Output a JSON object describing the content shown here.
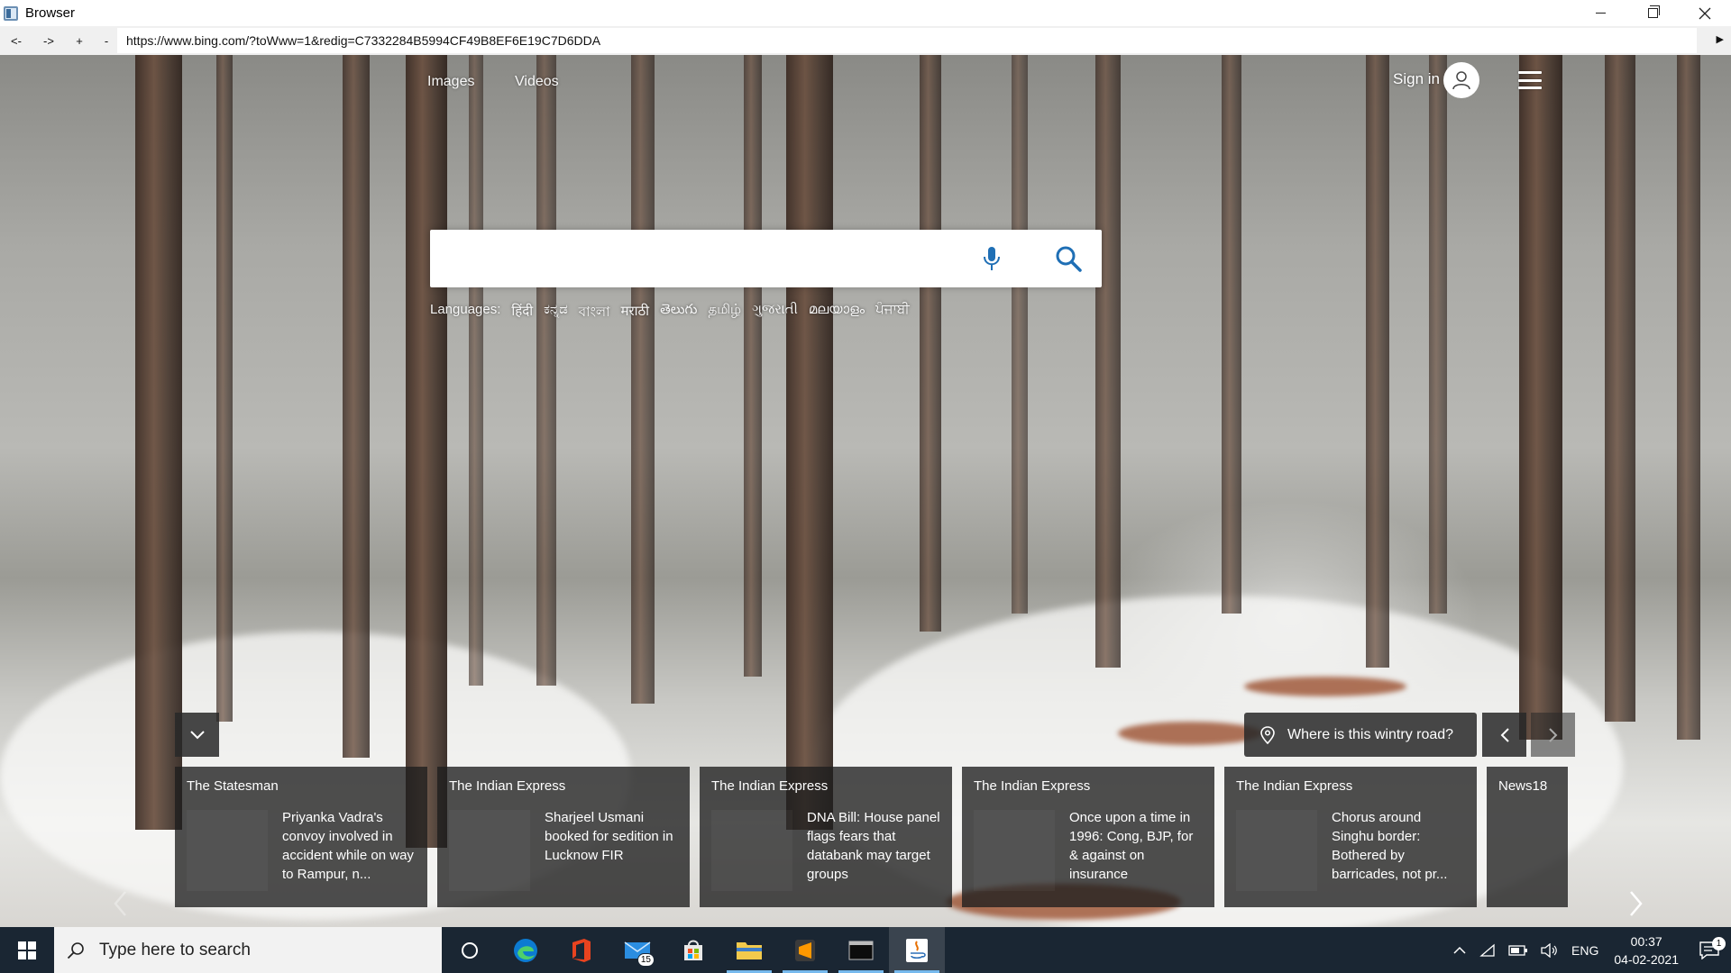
{
  "window": {
    "title": "Browser",
    "minimize": "–",
    "maximize": "❐",
    "close": "✕"
  },
  "navbar": {
    "back": "<-",
    "forward": "->",
    "zoom_in": "+",
    "zoom_out": "-",
    "url": "https://www.bing.com/?toWww=1&redig=C7332284B5994CF49B8EF6E19C7D6DDA",
    "go": "▶"
  },
  "bing": {
    "nav": {
      "images": "Images",
      "videos": "Videos"
    },
    "signin": "Sign in",
    "search": {
      "placeholder": "",
      "value": ""
    },
    "languages_label": "Languages:",
    "languages": [
      "हिंदी",
      "ಕನ್ನಡ",
      "বাংলা",
      "मराठी",
      "తెలుగు",
      "தமிழ்",
      "ગુજરાતી",
      "മലയാളം",
      "ਪੰਜਾਬੀ"
    ],
    "location_question": "Where is this wintry road?",
    "news": [
      {
        "source": "The Statesman",
        "headline": "Priyanka Vadra's convoy involved in accident while on way to Rampur, n..."
      },
      {
        "source": "The Indian Express",
        "headline": "Sharjeel Usmani booked for sedition in Lucknow FIR"
      },
      {
        "source": "The Indian Express",
        "headline": "DNA Bill: House panel flags fears that databank may target groups"
      },
      {
        "source": "The Indian Express",
        "headline": "Once upon a time in 1996: Cong, BJP, for & against on insurance"
      },
      {
        "source": "The Indian Express",
        "headline": "Chorus around Singhu border: Bothered by barricades, not pr..."
      },
      {
        "source": "News18",
        "headline": ""
      }
    ]
  },
  "taskbar": {
    "search_placeholder": "Type here to search",
    "mail_badge": "15",
    "tray": {
      "language": "ENG",
      "time": "00:37",
      "date": "04-02-2021",
      "notifications": "1"
    }
  },
  "colors": {
    "taskbar": "#1a2633",
    "accent": "#76b9ed",
    "bing_blue": "#1f6fb5"
  }
}
